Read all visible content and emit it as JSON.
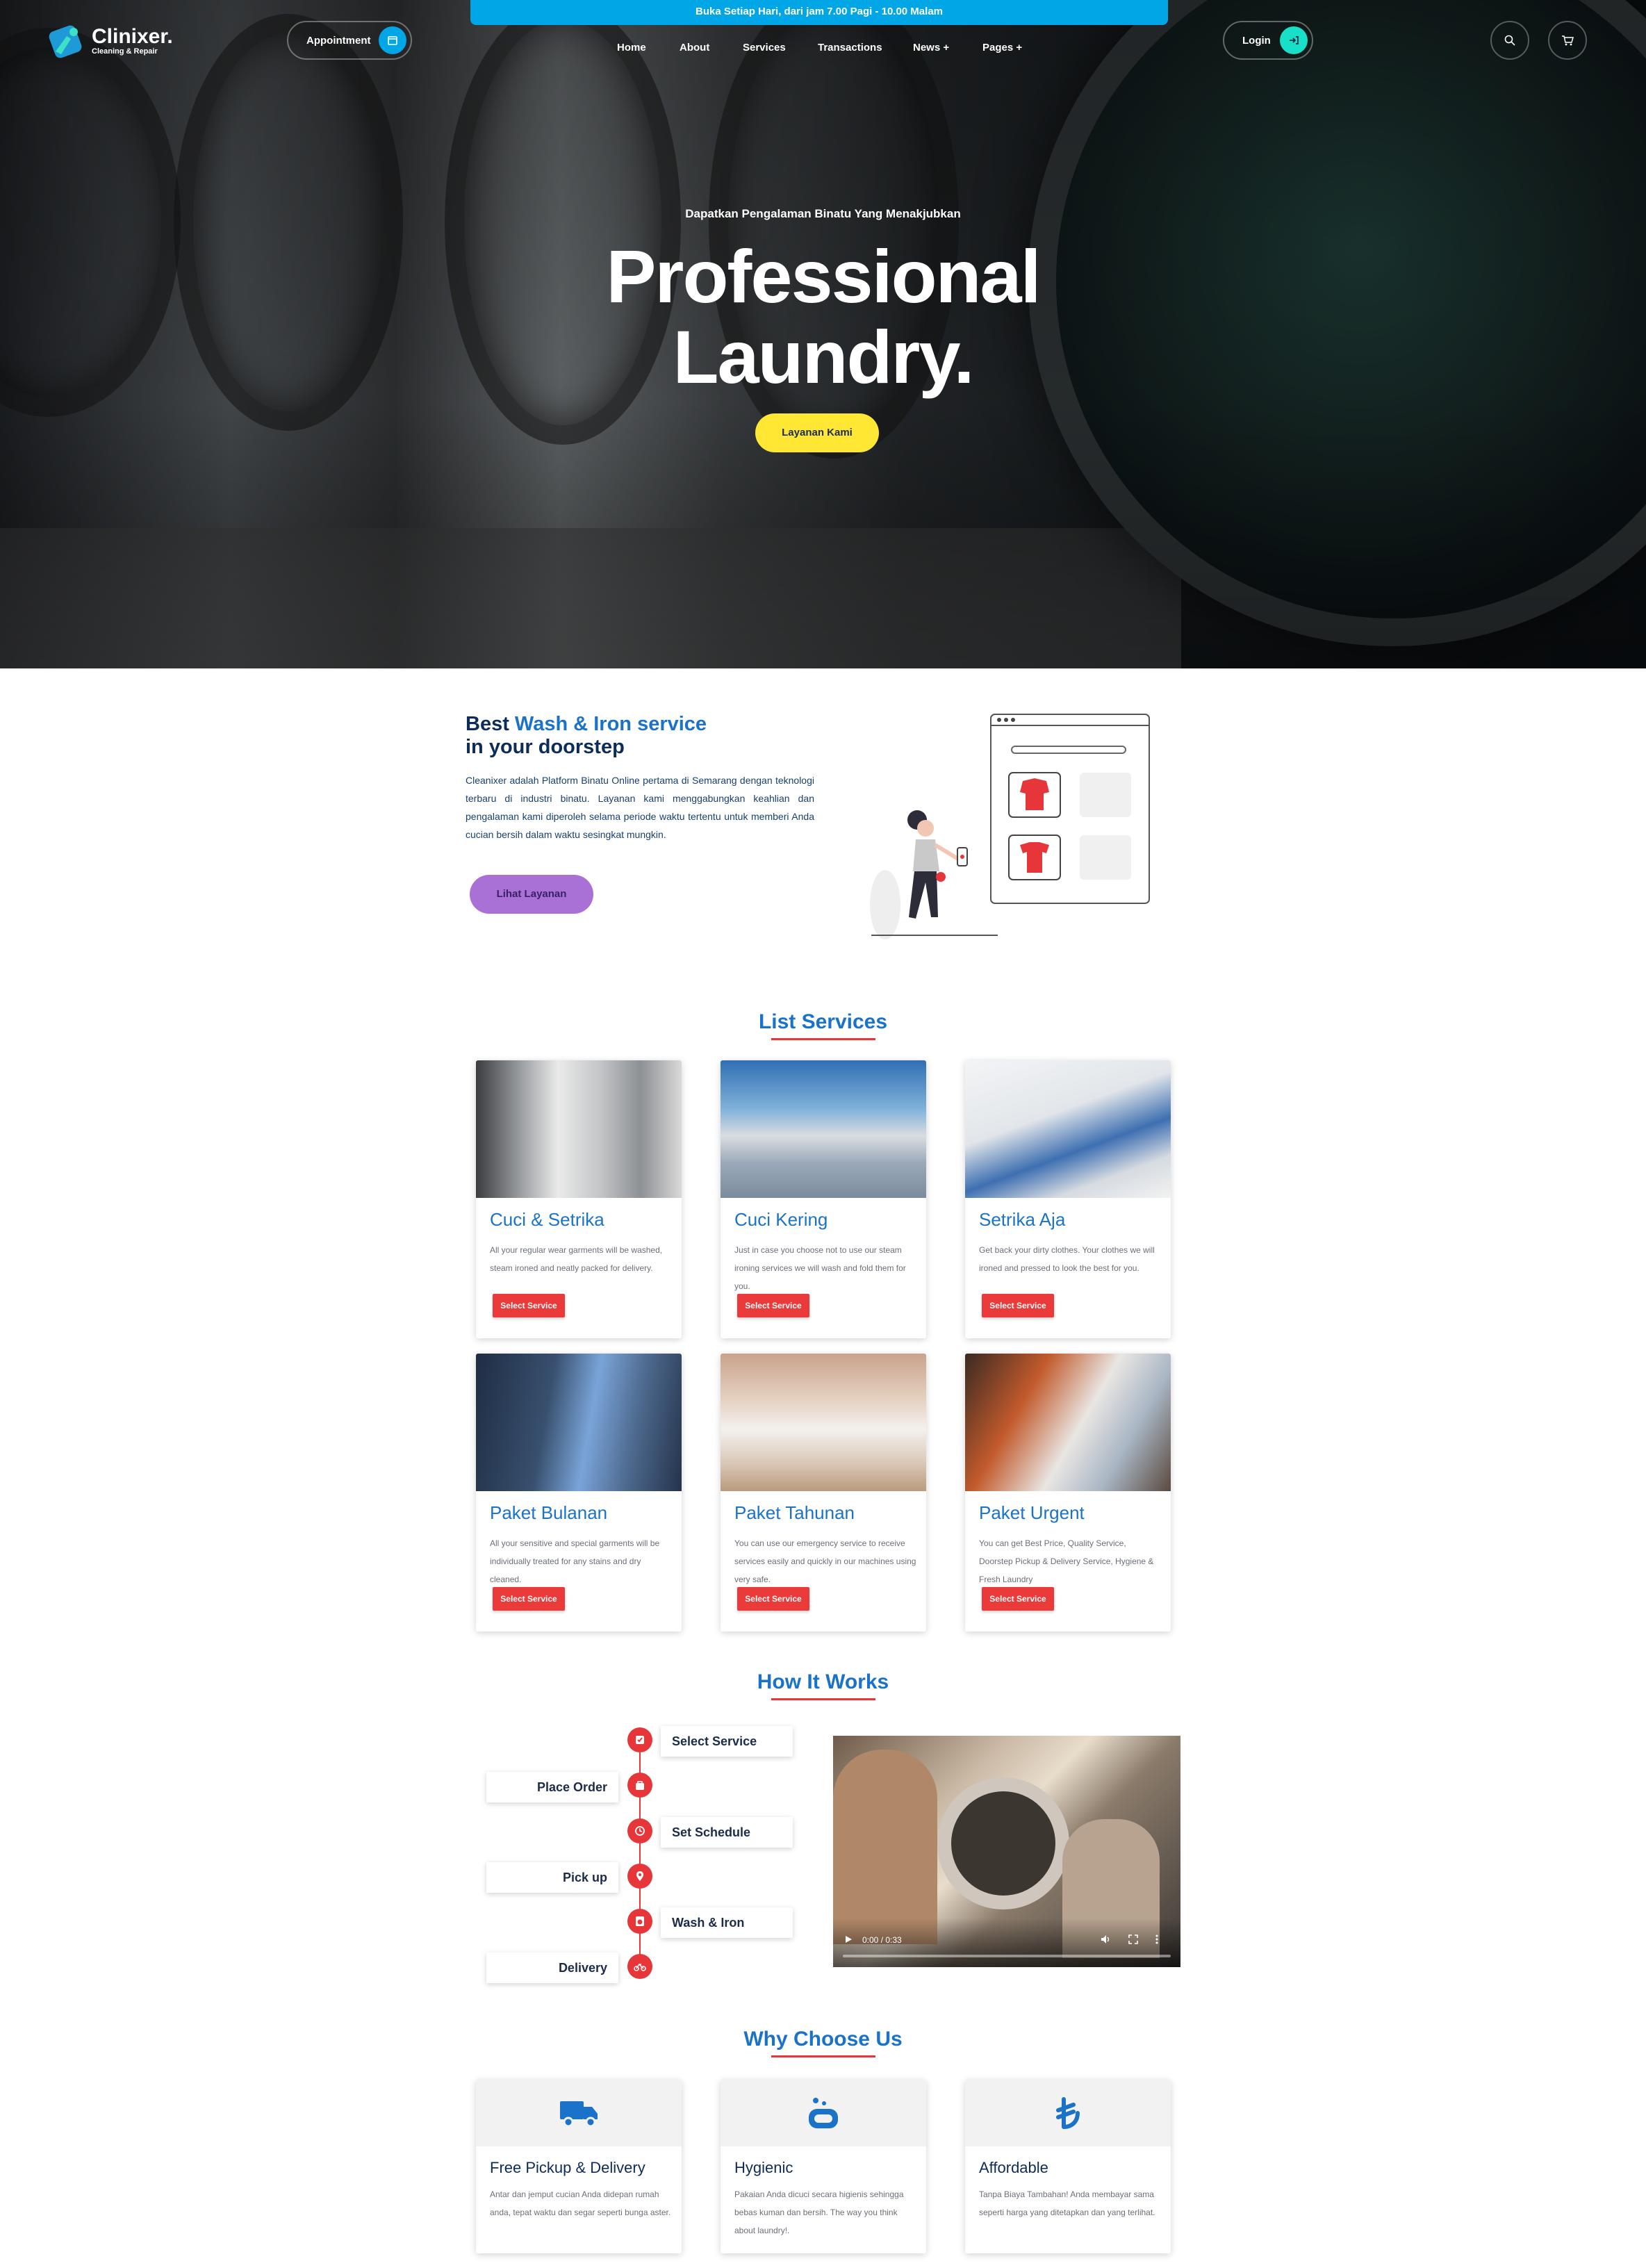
{
  "topbar": {
    "text": "Buka Setiap Hari, dari jam 7.00 Pagi - 10.00 Malam"
  },
  "brand": {
    "name": "Clinixer.",
    "tagline": "Cleaning & Repair"
  },
  "header": {
    "appointment_label": "Appointment",
    "login_label": "Login",
    "nav": [
      "Home",
      "About",
      "Services",
      "Transactions",
      "News +",
      "Pages +"
    ]
  },
  "hero": {
    "subtitle": "Dapatkan Pengalaman Binatu Yang Menakjubkan",
    "title_line1": "Professional",
    "title_line2": "Laundry.",
    "cta_label": "Layanan Kami"
  },
  "intro": {
    "title_prefix": "Best ",
    "title_highlight": "Wash & Iron service",
    "title_line2": "in your doorstep",
    "text": "Cleanixer adalah Platform Binatu Online pertama di Semarang dengan teknologi terbaru di industri binatu. Layanan kami menggabungkan keahlian dan pengalaman kami diperoleh selama periode waktu tertentu untuk memberi Anda cucian bersih dalam waktu sesingkat mungkin.",
    "cta_label": "Lihat Layanan"
  },
  "services": {
    "title": "List Services",
    "button_label": "Select Service",
    "items": [
      {
        "title": "Cuci & Setrika",
        "desc": "All your regular wear garments will be washed, steam ironed and neatly packed for delivery."
      },
      {
        "title": "Cuci Kering",
        "desc": "Just in case you choose not to use our steam ironing services we will wash and fold them for you."
      },
      {
        "title": "Setrika Aja",
        "desc": "Get back your dirty clothes. Your clothes we will ironed and pressed to look the best for you."
      },
      {
        "title": "Paket Bulanan",
        "desc": "All your sensitive and special garments will be individually treated for any stains and dry cleaned."
      },
      {
        "title": "Paket Tahunan",
        "desc": "You can use our emergency service to receive services easily and quickly in our machines using very safe."
      },
      {
        "title": "Paket Urgent",
        "desc": "You can get Best Price, Quality Service, Doorstep Pickup & Delivery Service, Hygiene & Fresh Laundry"
      }
    ]
  },
  "how": {
    "title": "How It Works",
    "steps": [
      "Select Service",
      "Place Order",
      "Set Schedule",
      "Pick up",
      "Wash & Iron",
      "Delivery"
    ],
    "video_time": "0:00 / 0:33"
  },
  "why": {
    "title": "Why Choose Us",
    "items": [
      {
        "title": "Free Pickup & Delivery",
        "desc": "Antar dan jemput cucian Anda didepan rumah anda, tepat waktu dan segar seperti bunga aster.",
        "icon": "truck-icon"
      },
      {
        "title": "Hygienic",
        "desc": "Pakaian Anda dicuci secara higienis sehingga bebas kuman dan bersih. The way you think about laundry!.",
        "icon": "soap-icon"
      },
      {
        "title": "Affordable",
        "desc": "Tanpa Biaya Tambahan! Anda membayar sama seperti harga yang ditetapkan dan yang terlihat.",
        "icon": "currency-icon"
      }
    ]
  },
  "colors": {
    "accent": "#1a73c9",
    "red": "#e6363a",
    "yellow": "#ffe733",
    "cyan": "#00a6e6",
    "purple": "#a970d6"
  }
}
